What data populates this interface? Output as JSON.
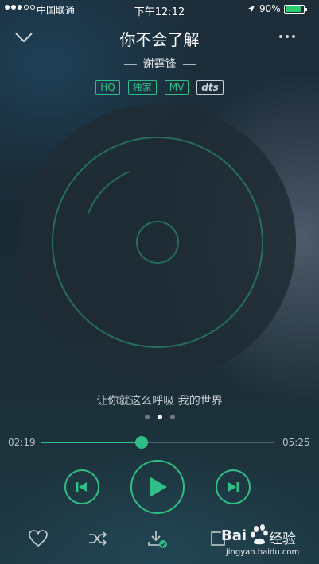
{
  "status_bar": {
    "carrier": "中国联通",
    "time": "下午12:12",
    "battery_percent": "90%",
    "battery_level": 0.9,
    "signal_bars": 3,
    "signal_total": 5
  },
  "song": {
    "title": "你不会了解",
    "artist": "谢霆锋",
    "badges": [
      "HQ",
      "独家",
      "MV",
      "dts"
    ]
  },
  "lyric": "让你就这么呼吸 我的世界",
  "pager": {
    "count": 3,
    "active_index": 1
  },
  "progress": {
    "current_time": "02:19",
    "total_time": "05:25",
    "fraction": 0.43
  },
  "icons": {
    "back": "chevron-down-icon",
    "more": "more-dots-icon",
    "prev": "previous-track-icon",
    "play": "play-icon",
    "next": "next-track-icon",
    "favorite": "heart-icon",
    "shuffle": "shuffle-icon",
    "download": "download-icon",
    "share": "share-icon"
  },
  "colors": {
    "accent": "#2fbf86",
    "background": "#1d2d3a"
  },
  "watermark": {
    "brand": "Baidu",
    "word": "经验",
    "url": "jingyan.baidu.com"
  }
}
